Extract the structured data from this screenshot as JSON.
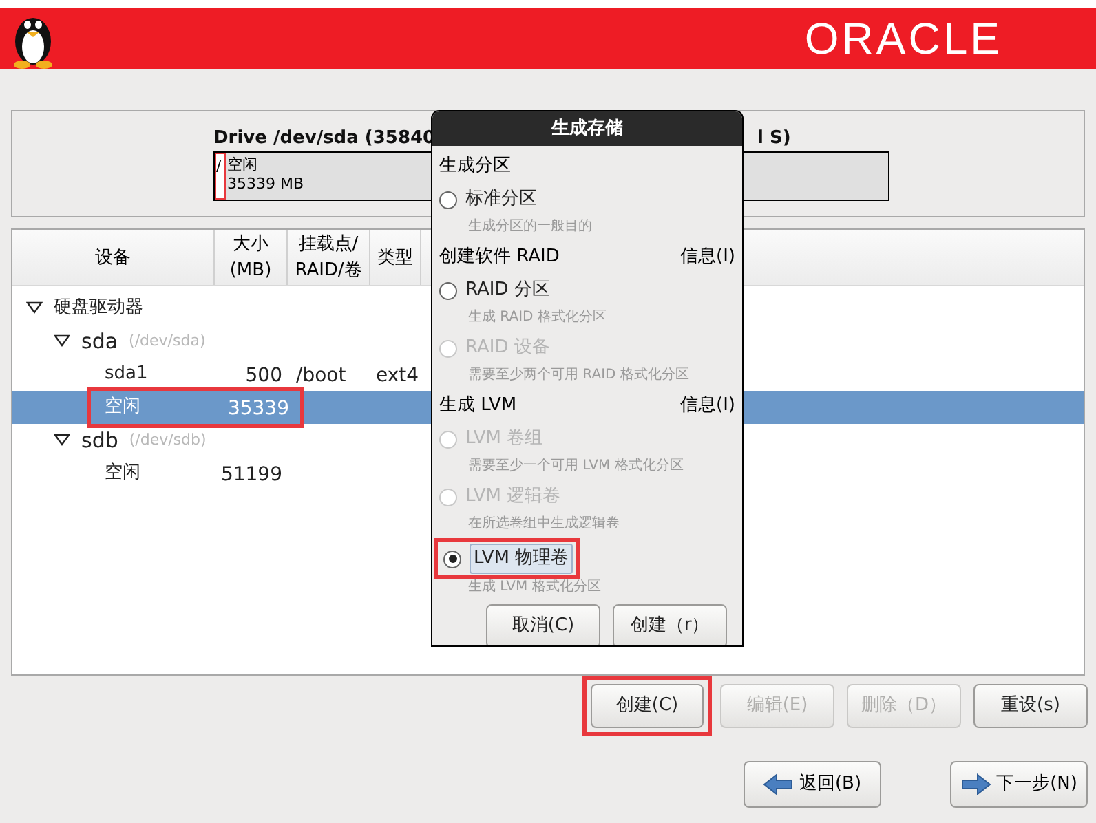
{
  "banner": {
    "logo": "ORACLE"
  },
  "drive": {
    "title_left": "Drive /dev/sda (35840",
    "title_right": "l S)",
    "segments": [
      {
        "name": "/",
        "selected": true
      },
      {
        "name": "空闲",
        "size": "35339 MB",
        "selected": false
      }
    ]
  },
  "table": {
    "columns": [
      "设备",
      "大小\n(MB)",
      "挂载点/\nRAID/卷",
      "类型"
    ],
    "rows": [
      {
        "device": "硬盘驱动器",
        "expanded": true,
        "children": [
          {
            "device": "sda",
            "path": "(/dev/sda)",
            "expanded": true,
            "children": [
              {
                "device": "sda1",
                "size": "500",
                "mount": "/boot",
                "type": "ext4",
                "selected": false,
                "highlighted": false
              },
              {
                "device": "空闲",
                "size": "35339",
                "selected": true,
                "highlighted": true
              }
            ]
          },
          {
            "device": "sdb",
            "path": "(/dev/sdb)",
            "expanded": true,
            "children": [
              {
                "device": "空闲",
                "size": "51199",
                "selected": false,
                "highlighted": false
              }
            ]
          }
        ]
      }
    ]
  },
  "actions": [
    {
      "label": "创建(C)",
      "disabled": false,
      "highlighted": true
    },
    {
      "label": "编辑(E)",
      "disabled": true,
      "highlighted": false
    },
    {
      "label": "删除（D）",
      "disabled": true,
      "highlighted": false
    },
    {
      "label": "重设(s)",
      "disabled": false,
      "highlighted": false
    }
  ],
  "navigation": {
    "back": "返回(B)",
    "next": "下一步(N)"
  },
  "dialog": {
    "title": "生成存储",
    "sections": [
      {
        "heading": "生成分区",
        "options": [
          {
            "label": "标准分区",
            "hint": "生成分区的一般目的",
            "disabled": false,
            "selected": false,
            "highlighted": false
          }
        ]
      },
      {
        "heading": "创建软件 RAID",
        "info": "信息(I)",
        "options": [
          {
            "label": "RAID 分区",
            "hint": "生成 RAID 格式化分区",
            "disabled": false,
            "selected": false,
            "highlighted": false
          },
          {
            "label": "RAID 设备",
            "hint": "需要至少两个可用 RAID 格式化分区",
            "disabled": true,
            "selected": false,
            "highlighted": false
          }
        ]
      },
      {
        "heading": "生成 LVM",
        "info": "信息(I)",
        "options": [
          {
            "label": "LVM 卷组",
            "hint": "需要至少一个可用 LVM 格式化分区",
            "disabled": true,
            "selected": false,
            "highlighted": false
          },
          {
            "label": "LVM 逻辑卷",
            "hint": "在所选卷组中生成逻辑卷",
            "disabled": true,
            "selected": false,
            "highlighted": false
          },
          {
            "label": "LVM 物理卷",
            "hint": "生成 LVM 格式化分区",
            "disabled": false,
            "selected": true,
            "highlighted": true
          }
        ]
      }
    ],
    "buttons": [
      "取消(C)",
      "创建（r）"
    ]
  }
}
